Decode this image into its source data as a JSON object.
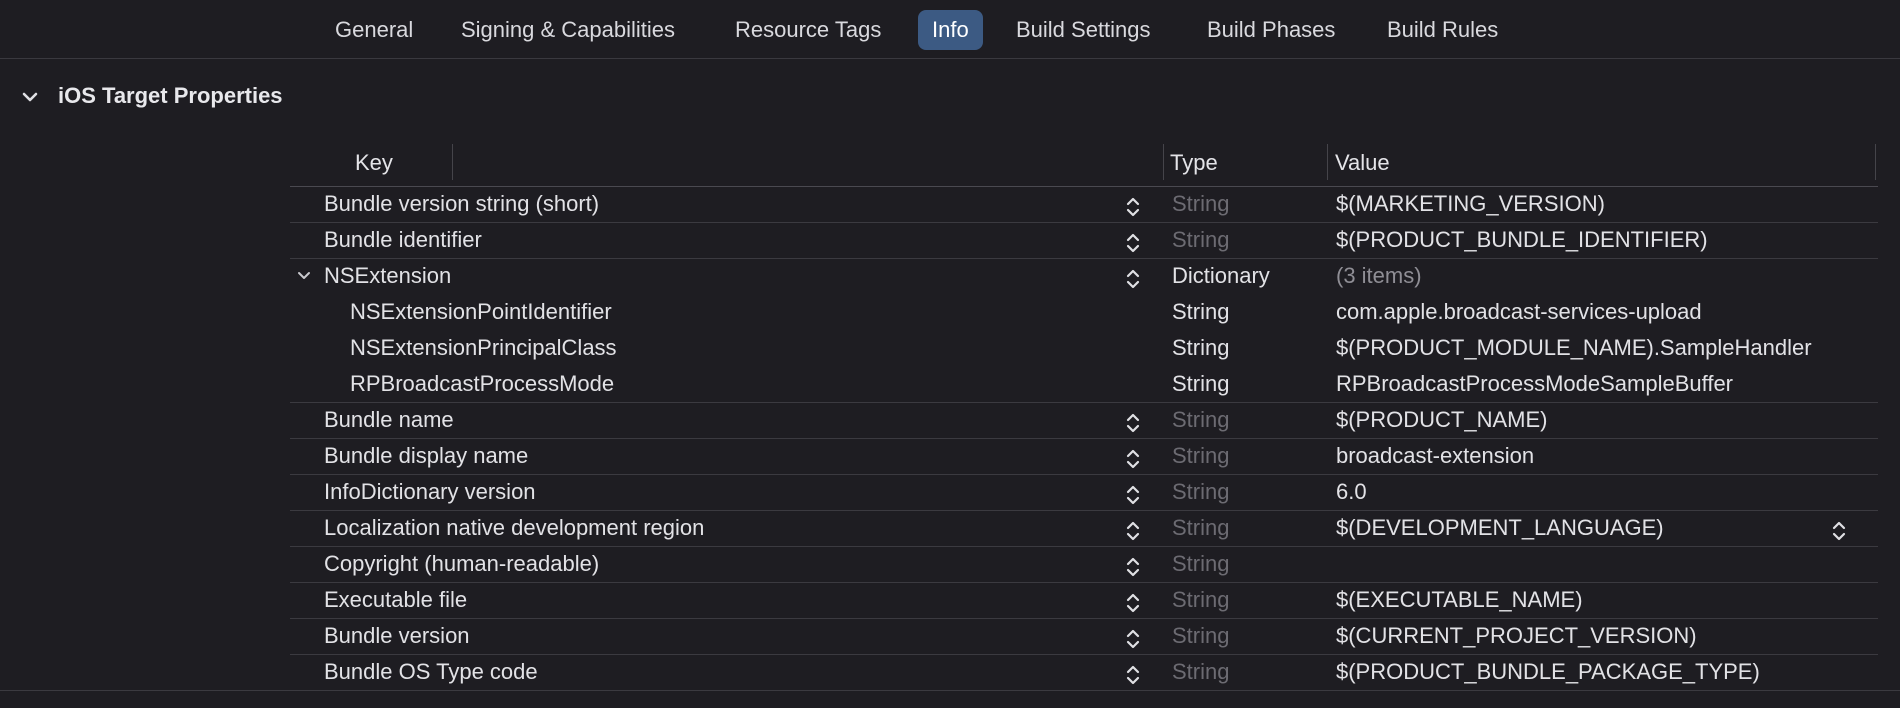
{
  "tabs": [
    "General",
    "Signing & Capabilities",
    "Resource Tags",
    "Info",
    "Build Settings",
    "Build Phases",
    "Build Rules"
  ],
  "active_tab": "Info",
  "section": {
    "title": "iOS Target Properties"
  },
  "table": {
    "headers": {
      "key": "Key",
      "type": "Type",
      "value": "Value"
    },
    "rows": [
      {
        "key": "Bundle version string (short)",
        "type": "String",
        "value": "$(MARKETING_VERSION)"
      },
      {
        "key": "Bundle identifier",
        "type": "String",
        "value": "$(PRODUCT_BUNDLE_IDENTIFIER)"
      },
      {
        "key": "NSExtension",
        "type": "Dictionary",
        "value": "(3 items)",
        "expanded": true
      },
      {
        "key": "NSExtensionPointIdentifier",
        "type": "String",
        "value": "com.apple.broadcast-services-upload",
        "child": true
      },
      {
        "key": "NSExtensionPrincipalClass",
        "type": "String",
        "value": "$(PRODUCT_MODULE_NAME).SampleHandler",
        "child": true
      },
      {
        "key": "RPBroadcastProcessMode",
        "type": "String",
        "value": "RPBroadcastProcessModeSampleBuffer",
        "child": true
      },
      {
        "key": "Bundle name",
        "type": "String",
        "value": "$(PRODUCT_NAME)"
      },
      {
        "key": "Bundle display name",
        "type": "String",
        "value": "broadcast-extension"
      },
      {
        "key": "InfoDictionary version",
        "type": "String",
        "value": "6.0"
      },
      {
        "key": "Localization native development region",
        "type": "String",
        "value": "$(DEVELOPMENT_LANGUAGE)",
        "value_stepper": true
      },
      {
        "key": "Copyright (human-readable)",
        "type": "String",
        "value": ""
      },
      {
        "key": "Executable file",
        "type": "String",
        "value": "$(EXECUTABLE_NAME)"
      },
      {
        "key": "Bundle version",
        "type": "String",
        "value": "$(CURRENT_PROJECT_VERSION)"
      },
      {
        "key": "Bundle OS Type code",
        "type": "String",
        "value": "$(PRODUCT_BUNDLE_PACKAGE_TYPE)"
      }
    ]
  },
  "colors": {
    "background": "#1e1d22",
    "accent": "#3c5a83",
    "dim_text": "#6c6b72"
  },
  "icons": {
    "section_toggle": "chevron-down-icon",
    "row_disclosure": "chevron-down-icon",
    "stepper": "up-down-stepper-icon"
  }
}
